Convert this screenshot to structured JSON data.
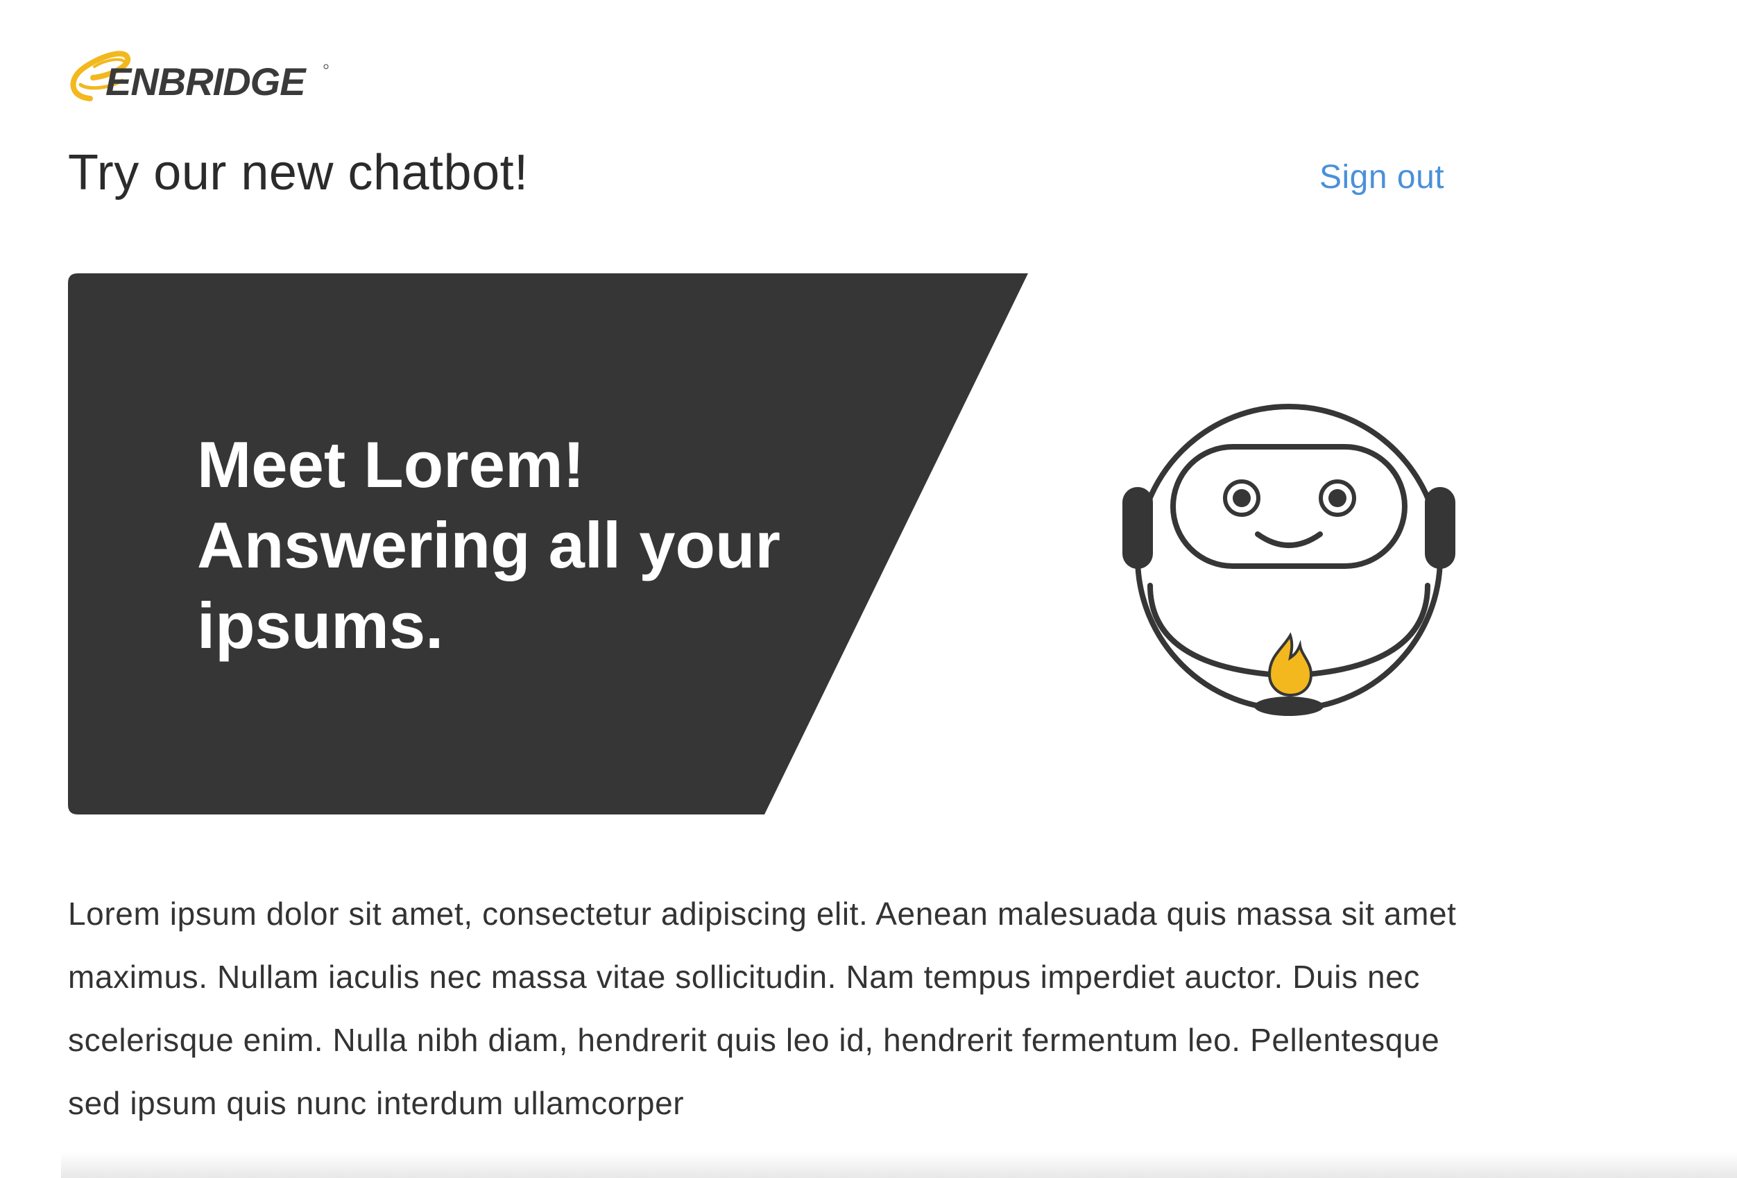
{
  "brand": {
    "name": "ENBRIDGE",
    "colors": {
      "accent_yellow": "#f2b81d",
      "text_dark": "#3a3a3a"
    }
  },
  "header": {
    "title": "Try our new chatbot!",
    "sign_out_label": "Sign out",
    "link_color": "#4a90d9"
  },
  "hero": {
    "headline_lines": [
      "Meet Lorem!",
      "Answering all your",
      "ipsums."
    ],
    "panel_color": "#363636",
    "mascot_icon": "chatbot-robot-icon",
    "mascot_emblem_icon": "flame-icon"
  },
  "main": {
    "body_text": "Lorem ipsum dolor sit amet, consectetur adipiscing elit. Aenean malesuada quis massa sit amet maximus. Nullam iaculis nec massa vitae sollicitudin. Nam tempus imperdiet auctor. Duis nec scelerisque enim. Nulla nibh diam, hendrerit quis leo id, hendrerit fermentum leo. Pellentesque sed ipsum quis nunc interdum ullamcorper"
  }
}
